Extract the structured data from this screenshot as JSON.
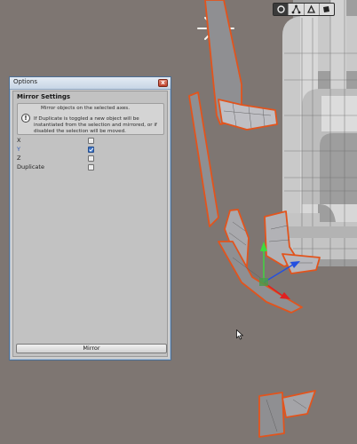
{
  "scene_toolbar": {
    "buttons": [
      {
        "icon": "center-pivot-icon",
        "active": true
      },
      {
        "icon": "vertex-mode-icon",
        "active": false
      },
      {
        "icon": "edge-mode-icon",
        "active": false
      },
      {
        "icon": "face-mode-icon",
        "active": false
      }
    ]
  },
  "options_window": {
    "title": "Options",
    "close_glyph": "x",
    "section_title": "Mirror Settings",
    "info_icon": "!",
    "info_line1": "Mirror objects on the selected axes.",
    "info_line2": "If Duplicate is toggled a new object will be instantiated from the selection and mirrored, or if disabled the selection will be moved.",
    "fields": [
      {
        "label": "X",
        "checked": false,
        "highlighted": false
      },
      {
        "label": "Y",
        "checked": true,
        "highlighted": true
      },
      {
        "label": "Z",
        "checked": false,
        "highlighted": false
      },
      {
        "label": "Duplicate",
        "checked": false,
        "highlighted": false
      }
    ],
    "action_button": "Mirror"
  },
  "colors": {
    "viewport_bg": "#7e7672",
    "selection_outline": "#e2541d",
    "mesh_fill": "#8f8f92",
    "checked_blue": "#3d73c5",
    "axis_y_green": "#3ddc3d",
    "axis_x_red": "#e02020",
    "axis_z_blue": "#2450e0"
  }
}
